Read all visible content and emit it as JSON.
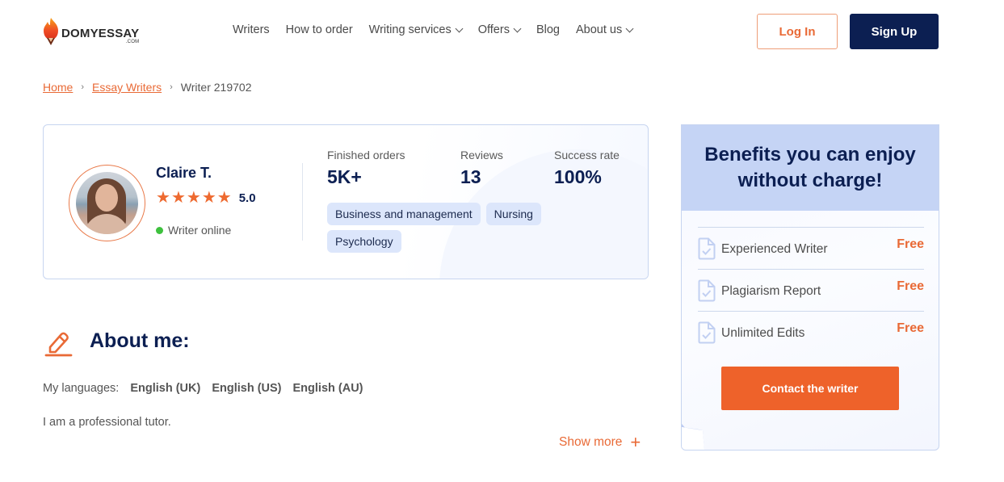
{
  "header": {
    "logo": {
      "text": "DOMYESSAY",
      "suffix": ".COM"
    },
    "nav": [
      {
        "label": "Writers",
        "dropdown": false
      },
      {
        "label": "How to order",
        "dropdown": false
      },
      {
        "label": "Writing services",
        "dropdown": true
      },
      {
        "label": "Offers",
        "dropdown": true
      },
      {
        "label": "Blog",
        "dropdown": false
      },
      {
        "label": "About us",
        "dropdown": true
      }
    ],
    "login_label": "Log In",
    "signup_label": "Sign Up"
  },
  "breadcrumb": {
    "items": [
      {
        "label": "Home",
        "link": true
      },
      {
        "label": "Essay Writers",
        "link": true
      },
      {
        "label": "Writer 219702",
        "link": false
      }
    ],
    "separator": "›"
  },
  "profile": {
    "name": "Claire T.",
    "rating": "5.0",
    "stars": 5,
    "status": "Writer online",
    "stats": [
      {
        "label": "Finished orders",
        "value": "5K+"
      },
      {
        "label": "Reviews",
        "value": "13"
      },
      {
        "label": "Success rate",
        "value": "100%"
      }
    ],
    "subjects": [
      "Business and management",
      "Nursing",
      "Psychology"
    ]
  },
  "about": {
    "title": "About me:",
    "languages_label": "My languages:",
    "languages": [
      "English (UK)",
      "English (US)",
      "English (AU)"
    ],
    "bio": "I am a professional tutor.",
    "show_more_label": "Show more",
    "show_more_icon": "+"
  },
  "benefits": {
    "title_line1": "Benefits you can enjoy",
    "title_line2": "without charge!",
    "items": [
      {
        "label": "Experienced Writer",
        "price": "Free"
      },
      {
        "label": "Plagiarism Report",
        "price": "Free"
      },
      {
        "label": "Unlimited Edits",
        "price": "Free"
      }
    ],
    "cta_label": "Contact the writer"
  },
  "colors": {
    "brand_orange": "#ee622a",
    "navy": "#0c1f52",
    "tag_bg": "#dce6fb",
    "online_green": "#3ec13e",
    "benefits_header_bg": "#c5d4f5"
  }
}
